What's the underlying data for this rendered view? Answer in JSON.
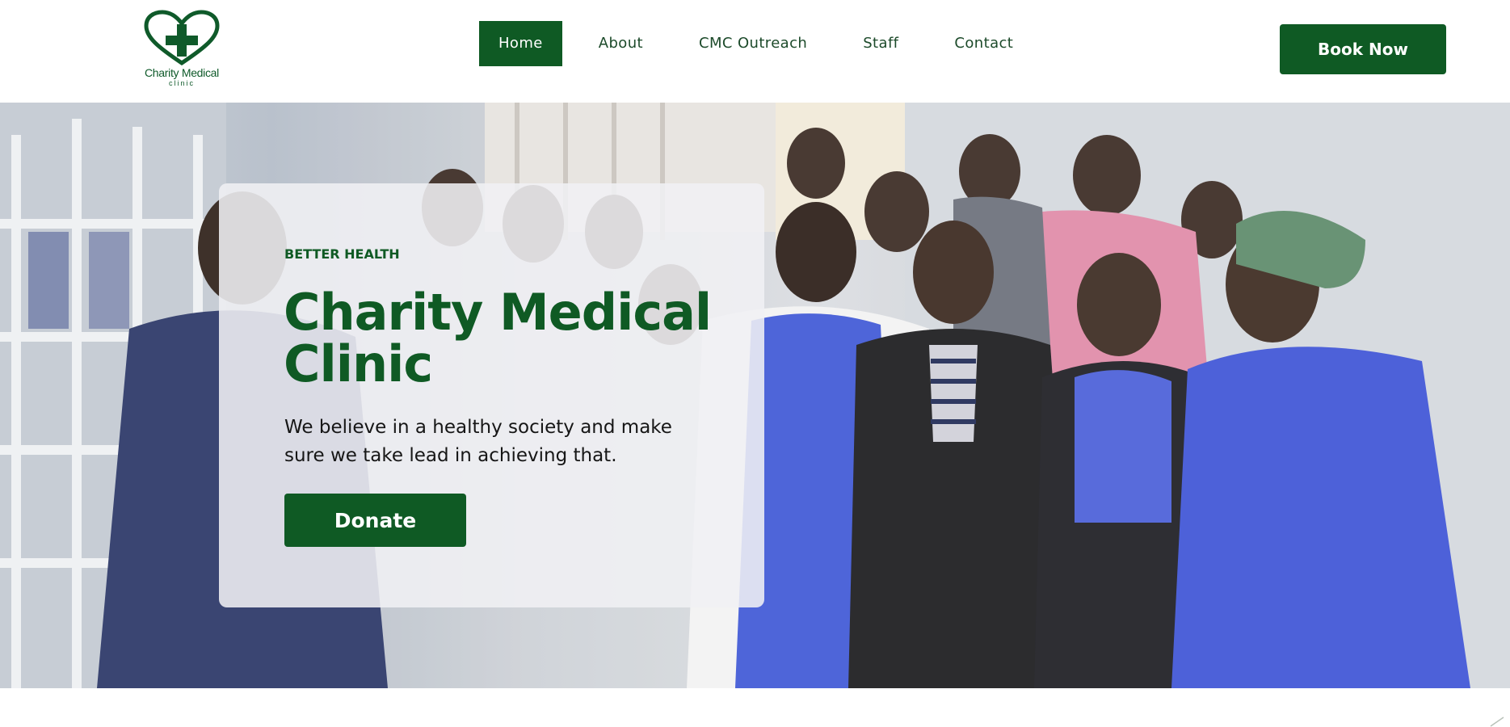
{
  "header": {
    "logo": {
      "name": "Charity Medical",
      "sub": "clinic",
      "icon": "heart-cross-icon"
    },
    "nav": [
      {
        "label": "Home",
        "active": true
      },
      {
        "label": "About",
        "active": false
      },
      {
        "label": "CMC Outreach",
        "active": false
      },
      {
        "label": "Staff",
        "active": false
      },
      {
        "label": "Contact",
        "active": false
      }
    ],
    "book_label": "Book Now"
  },
  "hero": {
    "eyebrow": "BETTER HEALTH",
    "title": "Charity Medical Clinic",
    "text": "We believe in a healthy society and make sure we take lead in achieving that.",
    "donate_label": "Donate",
    "background": "group-photo-of-clinic-staff"
  },
  "colors": {
    "brand_green": "#0f5a24",
    "nav_text": "#1c4a2a",
    "card_bg": "#f0f0f4"
  }
}
